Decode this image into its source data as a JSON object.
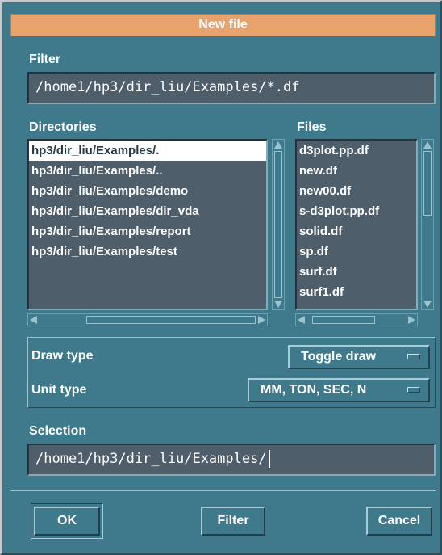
{
  "window": {
    "title": "New file"
  },
  "filter": {
    "label": "Filter",
    "value": "/home1/hp3/dir_liu/Examples/*.df"
  },
  "directories": {
    "label": "Directories",
    "items": [
      "hp3/dir_liu/Examples/.",
      "hp3/dir_liu/Examples/..",
      "hp3/dir_liu/Examples/demo",
      "hp3/dir_liu/Examples/dir_vda",
      "hp3/dir_liu/Examples/report",
      "hp3/dir_liu/Examples/test"
    ],
    "selected_index": 0
  },
  "files": {
    "label": "Files",
    "items": [
      "d3plot.pp.df",
      "new.df",
      "new00.df",
      "s-d3plot.pp.df",
      "solid.df",
      "sp.df",
      "surf.df",
      "surf1.df"
    ]
  },
  "options": {
    "draw_type": {
      "label": "Draw type",
      "value": "Toggle draw"
    },
    "unit_type": {
      "label": "Unit type",
      "value": "MM, TON, SEC, N"
    }
  },
  "selection": {
    "label": "Selection",
    "value": "/home1/hp3/dir_liu/Examples/"
  },
  "buttons": {
    "ok": "OK",
    "filter": "Filter",
    "cancel": "Cancel"
  },
  "colors": {
    "background": "#3e7a8c",
    "titlebar": "#e8a36c",
    "field": "#4e5e6a",
    "text": "#ffffff"
  }
}
